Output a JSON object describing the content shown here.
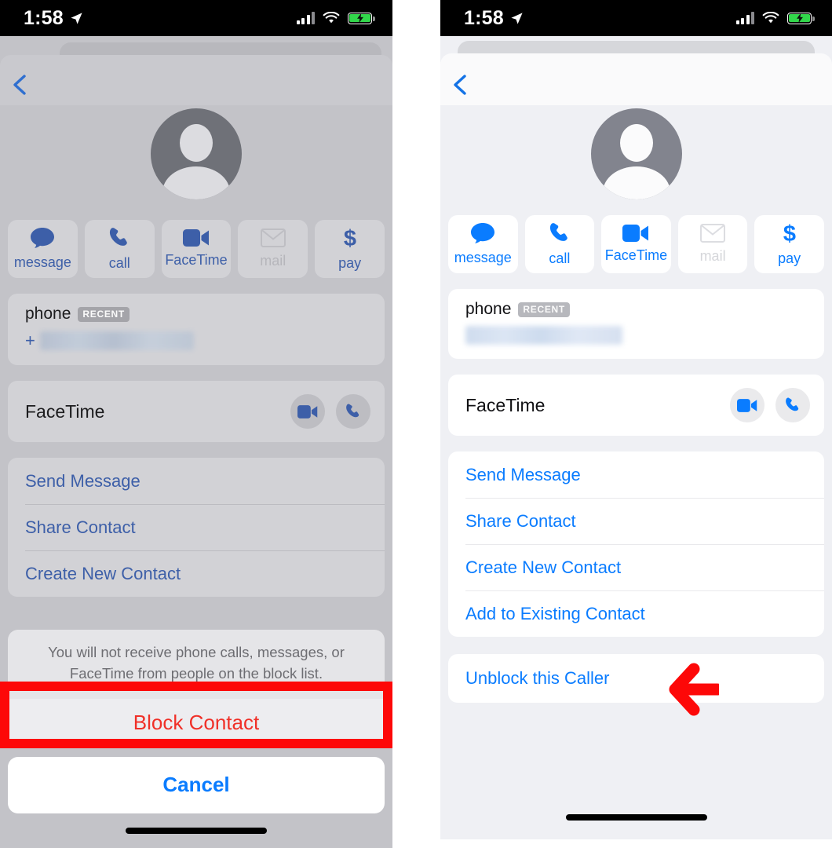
{
  "status_bar": {
    "time": "1:58",
    "location_icon": "location-arrow-icon",
    "signal_icon": "cellular-signal-icon",
    "wifi_icon": "wifi-icon",
    "battery_icon": "battery-charging-icon"
  },
  "colors": {
    "accent_blue": "#0a7cff",
    "accent_blue_dimmed": "#3d5fa8",
    "destructive_red": "#f03028",
    "annotation_red": "#fd0808",
    "battery_green": "#32d74b",
    "panel_left_bg": "#c3c3c8",
    "panel_right_bg": "#eff0f4"
  },
  "left_panel": {
    "back_label": "back-chevron",
    "avatar": "default-person-avatar",
    "actions": [
      {
        "label": "message",
        "icon": "message-bubble-icon",
        "disabled": false
      },
      {
        "label": "call",
        "icon": "phone-handset-icon",
        "disabled": false
      },
      {
        "label": "FaceTime",
        "icon": "video-camera-icon",
        "disabled": false
      },
      {
        "label": "mail",
        "icon": "envelope-icon",
        "disabled": true
      },
      {
        "label": "pay",
        "icon": "dollar-sign-icon",
        "disabled": false
      }
    ],
    "phone_field": {
      "label": "phone",
      "badge": "RECENT",
      "prefix": "+",
      "value_redacted": true
    },
    "facetime_row": {
      "label": "FaceTime",
      "video_icon": "video-camera-icon",
      "audio_icon": "phone-handset-icon"
    },
    "list_items": [
      "Send Message",
      "Share Contact",
      "Create New Contact"
    ],
    "alert": {
      "message": "You will not receive phone calls, messages, or FaceTime from people on the block list.",
      "confirm_label": "Block Contact",
      "cancel_label": "Cancel"
    }
  },
  "right_panel": {
    "back_label": "back-chevron",
    "avatar": "default-person-avatar",
    "actions": [
      {
        "label": "message",
        "icon": "message-bubble-icon",
        "disabled": false
      },
      {
        "label": "call",
        "icon": "phone-handset-icon",
        "disabled": false
      },
      {
        "label": "FaceTime",
        "icon": "video-camera-icon",
        "disabled": false
      },
      {
        "label": "mail",
        "icon": "envelope-icon",
        "disabled": true
      },
      {
        "label": "pay",
        "icon": "dollar-sign-icon",
        "disabled": false
      }
    ],
    "phone_field": {
      "label": "phone",
      "badge": "RECENT",
      "value_redacted": true
    },
    "facetime_row": {
      "label": "FaceTime",
      "video_icon": "video-camera-icon",
      "audio_icon": "phone-handset-icon"
    },
    "list_items": [
      "Send Message",
      "Share Contact",
      "Create New Contact",
      "Add to Existing Contact"
    ],
    "unblock_label": "Unblock this Caller"
  },
  "annotations": {
    "block_contact_highlight": "red-rectangle-highlight",
    "unblock_arrow": "red-left-arrow"
  }
}
